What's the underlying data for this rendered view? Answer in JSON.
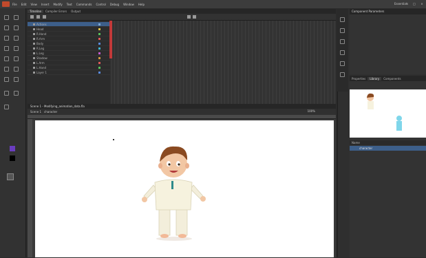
{
  "menu": {
    "items": [
      "File",
      "Edit",
      "View",
      "Insert",
      "Modify",
      "Text",
      "Commands",
      "Control",
      "Debug",
      "Window",
      "Help"
    ],
    "workspace": "Essentials"
  },
  "timeline": {
    "tabs": [
      "Timeline",
      "Compiler Errors",
      "Output"
    ],
    "layers": [
      {
        "name": "Actions",
        "color": "#7aa7d6",
        "selected": true
      },
      {
        "name": "Head",
        "color": "#e0c34a"
      },
      {
        "name": "R.Hand",
        "color": "#58c25b"
      },
      {
        "name": "R.Arm",
        "color": "#e05a5a"
      },
      {
        "name": "Body",
        "color": "#5a8be0"
      },
      {
        "name": "R.Leg",
        "color": "#3fb6d1"
      },
      {
        "name": "L.Leg",
        "color": "#c45ad1"
      },
      {
        "name": "Shadow",
        "color": "#d19a3f"
      },
      {
        "name": "L.Arm",
        "color": "#e05a5a"
      },
      {
        "name": "L.Hand",
        "color": "#58c25b"
      },
      {
        "name": "Layer 1",
        "color": "#5a8be0"
      }
    ]
  },
  "stage": {
    "title": "Scene 1 - Modifying_animation_data.fla",
    "crumb": "Scene 1",
    "symbol": "character",
    "zoom": "100%"
  },
  "right": {
    "comp_params_title": "Component Parameters",
    "lib_tabs": [
      "Properties",
      "Library",
      "Components"
    ],
    "lib_col": "Name",
    "lib_item": "character"
  },
  "colors": {
    "skin": "#f2c7a4",
    "hair": "#8a4a21",
    "shirt": "#f6f2de",
    "panel": "#2e2e2e"
  }
}
